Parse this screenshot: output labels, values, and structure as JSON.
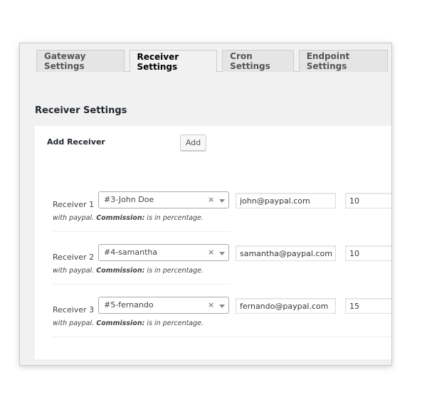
{
  "tabs": [
    {
      "label": "Gateway Settings",
      "active": false
    },
    {
      "label": "Receiver Settings",
      "active": true
    },
    {
      "label": "Cron Settings",
      "active": false
    },
    {
      "label": "Endpoint Settings",
      "active": false
    }
  ],
  "section_title": "Receiver Settings",
  "add_receiver": {
    "label": "Add Receiver",
    "button_label": "Add"
  },
  "help_text": {
    "prefix": "with paypal. ",
    "commission_label": "Commission:",
    "suffix": " is in percentage."
  },
  "receivers": [
    {
      "label": "Receiver 1",
      "selected": "#3-John Doe",
      "clear_glyph": "×",
      "email": "john@paypal.com",
      "commission": "10"
    },
    {
      "label": "Receiver 2",
      "selected": "#4-samantha",
      "clear_glyph": "×",
      "email": "samantha@paypal.com",
      "commission": "10"
    },
    {
      "label": "Receiver 3",
      "selected": "#5-fernando",
      "clear_glyph": "×",
      "email": "fernando@paypal.com",
      "commission": "15"
    }
  ],
  "colors": {
    "window_bg": "#f1f1f1",
    "panel_bg": "#ffffff",
    "tab_inactive": "#e5e5e5"
  }
}
